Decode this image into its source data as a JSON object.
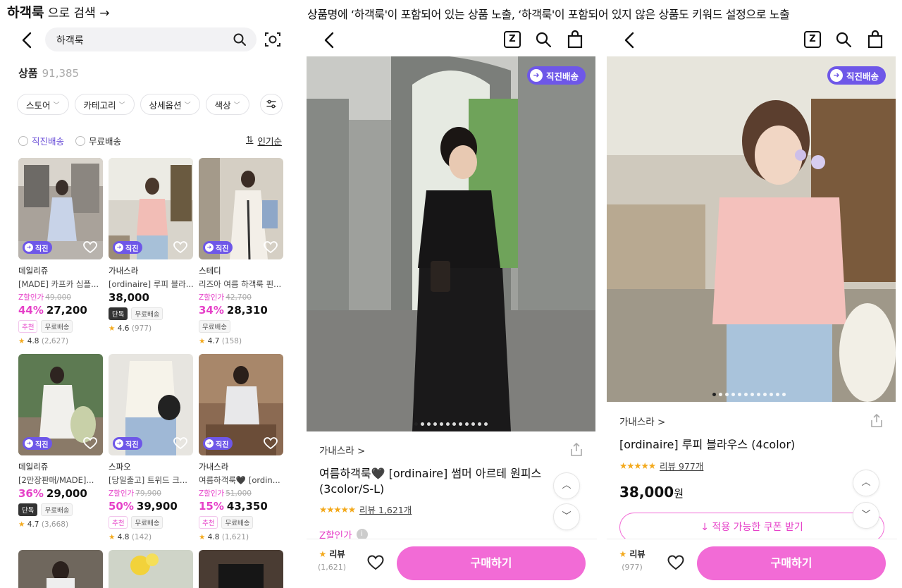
{
  "captions": {
    "left_bold": "하객룩",
    "left_rest": " 으로 검색 →",
    "right": "상품명에 ‘하객룩'이 포함되어 있는 상품 노출, ‘하객룩'이 포함되어 있지 않은 상품도 키워드 설정으로 노출"
  },
  "search": {
    "query": "하객룩",
    "results_label": "상품",
    "results_count": "91,385",
    "chips": [
      "스토어",
      "카테고리",
      "상세옵션",
      "색상"
    ],
    "options": [
      "직진배송",
      "무료배송"
    ],
    "sort": "인기순"
  },
  "badge_label": "직진",
  "products": [
    {
      "seller": "데일리쥬",
      "name": "[MADE] 카프카 심플...",
      "zlabel": "Z할인가",
      "orig": "49,000",
      "pct": "44%",
      "price": "27,200",
      "tags": [
        "추천",
        "무료배송"
      ],
      "rating": "4.8",
      "reviews": "(2,627)"
    },
    {
      "seller": "가내스라",
      "name": "[ordinaire] 루피 블라...",
      "zlabel": "",
      "orig": "",
      "pct": "",
      "price": "38,000",
      "tags": [
        "단독",
        "무료배송"
      ],
      "rating": "4.6",
      "reviews": "(977)"
    },
    {
      "seller": "스테디",
      "name": "리즈아 여름 하객룩 핀...",
      "zlabel": "Z할인가",
      "orig": "42,700",
      "pct": "34%",
      "price": "28,310",
      "tags": [
        "무료배송"
      ],
      "rating": "4.7",
      "reviews": "(158)"
    },
    {
      "seller": "데일리쥬",
      "name": "[2만장판매/MADE]...",
      "zlabel": "",
      "orig": "",
      "pct": "36%",
      "price": "29,000",
      "tags": [
        "단독",
        "무료배송"
      ],
      "rating": "4.7",
      "reviews": "(3,668)"
    },
    {
      "seller": "스파오",
      "name": "[당일출고] 트위드 크...",
      "zlabel": "Z할인가",
      "orig": "79,900",
      "pct": "50%",
      "price": "39,900",
      "tags": [
        "추천",
        "무료배송"
      ],
      "rating": "4.8",
      "reviews": "(142)"
    },
    {
      "seller": "가내스라",
      "name": "여름하객룩🖤 [ordin...",
      "zlabel": "Z할인가",
      "orig": "51,000",
      "pct": "15%",
      "price": "43,350",
      "tags": [
        "추천",
        "무료배송"
      ],
      "rating": "4.8",
      "reviews": "(1,621)"
    }
  ],
  "detail_dress": {
    "badge": "직진배송",
    "store": "가내스라 >",
    "title": "여름하객룩🖤 [ordinaire] 썸머 아르테 원피스 (3color/S-L)",
    "stars": "★★★★★",
    "reviews_link": "리뷰 1,621개",
    "zsale": "Z할인가",
    "review_label": "리뷰",
    "review_count": "(1,621)",
    "buy": "구매하기"
  },
  "detail_blouse": {
    "badge": "직진배송",
    "store": "가내스라 >",
    "title": "[ordinaire] 루피 블라우스 (4color)",
    "stars": "★★★★★",
    "reviews_link": "리뷰 977개",
    "price": "38,000",
    "price_unit": "원",
    "coupon": "↓  적용 가능한 쿠폰 받기",
    "review_label": "리뷰",
    "review_count": "(977)",
    "buy": "구매하기"
  },
  "colors": {
    "accent_pink": "#f26bd6",
    "purple": "#6e57e8",
    "star": "#f3a91c"
  }
}
